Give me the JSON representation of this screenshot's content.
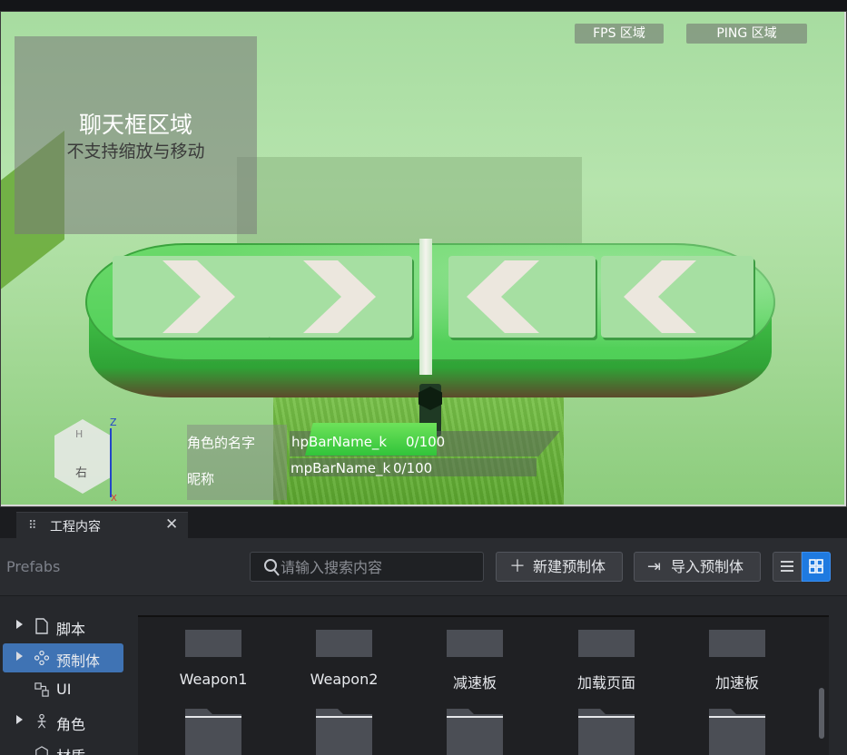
{
  "viewport": {
    "chat_title": "聊天框区域",
    "chat_subtitle": "不支持缩放与移动",
    "fps_label": "FPS 区域",
    "ping_label": "PING 区域",
    "gizmo_face": "右",
    "gizmo_top": "H",
    "gizmo_z": "Z",
    "gizmo_x": "X",
    "role_name_label": "角色的名字",
    "nickname_label": "昵称",
    "hp_bar_name": "hpBarName_k",
    "hp_value": "0/100",
    "mp_bar_name": "mpBarName_k",
    "mp_value": "0/100"
  },
  "panel": {
    "tab_label": "工程内容",
    "tab_close": "✕",
    "breadcrumb": "Prefabs",
    "search_placeholder": "请输入搜索内容",
    "new_prefab_label": "新建预制体",
    "import_prefab_label": "导入预制体",
    "tree": [
      {
        "label": "脚本",
        "icon": "file-icon",
        "expandable": true,
        "selected": false
      },
      {
        "label": "预制体",
        "icon": "prefab-icon",
        "expandable": true,
        "selected": true
      },
      {
        "label": "UI",
        "icon": "ui-icon",
        "expandable": false,
        "selected": false
      },
      {
        "label": "角色",
        "icon": "character-icon",
        "expandable": true,
        "selected": false
      },
      {
        "label": "材质",
        "icon": "material-icon",
        "expandable": false,
        "selected": false
      }
    ],
    "assets_row1": [
      "Weapon1",
      "Weapon2",
      "减速板",
      "加载页面",
      "加速板"
    ],
    "assets_row2_count_label": ""
  },
  "colors": {
    "accent": "#1f7ae0",
    "selected_item": "#3f73b4",
    "platform_green": "#4fcf57"
  }
}
